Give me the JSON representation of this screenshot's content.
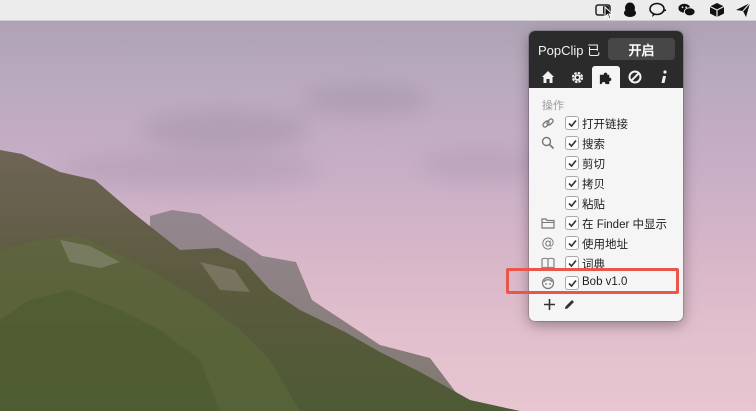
{
  "popup": {
    "title": "PopClip 已",
    "toggle_label": "开启",
    "tabs": [
      {
        "icon": "home-icon"
      },
      {
        "icon": "gear-icon"
      },
      {
        "icon": "puzzle-icon",
        "active": true
      },
      {
        "icon": "blocked-icon"
      },
      {
        "icon": "info-icon"
      }
    ],
    "section_title": "操作",
    "items": [
      {
        "icon": "link-icon",
        "label": "打开链接",
        "checked": true
      },
      {
        "icon": "search-icon",
        "label": "搜索",
        "checked": true
      },
      {
        "icon": "",
        "label": "剪切",
        "checked": true
      },
      {
        "icon": "",
        "label": "拷贝",
        "checked": true
      },
      {
        "icon": "",
        "label": "粘贴",
        "checked": true
      },
      {
        "icon": "folder-icon",
        "label": "在 Finder 中显示",
        "checked": true
      },
      {
        "icon": "at-icon",
        "label": "使用地址",
        "checked": true
      },
      {
        "icon": "book-icon",
        "label": "词典",
        "checked": true
      },
      {
        "icon": "bob-icon",
        "label": "Bob v1.0",
        "checked": true
      }
    ],
    "footer": {
      "add_icon": "plus-icon",
      "edit_icon": "pencil-icon"
    }
  },
  "menubar": {
    "icons": [
      "popclip-menu-icon",
      "qq-icon",
      "chat-bubble-icon",
      "wechat-icon",
      "box-icon",
      "send-icon"
    ]
  },
  "colors": {
    "highlight": "#e8574a",
    "popup_header": "#2b2b2b"
  }
}
